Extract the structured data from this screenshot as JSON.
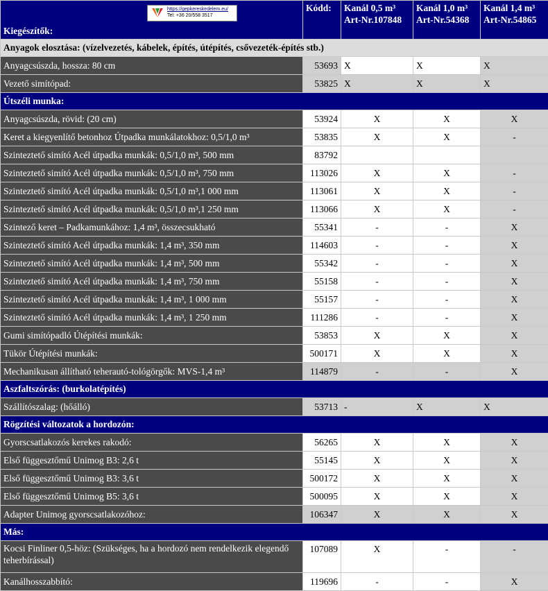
{
  "logo": {
    "url": "https://gepkereskedelem.eu/",
    "tel": "Tel:    +36 20/558 3517"
  },
  "header": {
    "title": "Kiegészítők:",
    "code": "Kódd:",
    "k1_line1": "Kanál 0,5 m³",
    "k1_line2": "Art-Nr.107848",
    "k2_line1": "Kanál 1,0 m³",
    "k2_line2": "Art-Nr.54368",
    "k3_line1": "Kanál 1,4 m³",
    "k3_line2": "Art-Nr.54865"
  },
  "sections": [
    {
      "title": "Anyagok elosztása: (vízelvezetés, kábelek, építés, útépítés, csővezeték-építés stb.)",
      "grey": true,
      "align_left": true,
      "rows": [
        {
          "name": "Anyagcsúszda, hossza: 80 cm",
          "code": "53693",
          "k1": "X",
          "k2": "X",
          "k3": "X",
          "bg": [
            "g",
            "w",
            "w",
            "g"
          ]
        },
        {
          "name": "Vezető simítópad:",
          "code": "53825",
          "k1": "X",
          "k2": "X",
          "k3": "X",
          "bg": [
            "g",
            "g",
            "g",
            "g"
          ]
        }
      ]
    },
    {
      "title": "Útszéli munka:",
      "grey": false,
      "rows": [
        {
          "name": "Anyagcsúszda, rövid: (20 cm)",
          "code": "53924",
          "k1": "X",
          "k2": "X",
          "k3": "X",
          "bg": [
            "w",
            "w",
            "w",
            "g"
          ]
        },
        {
          "name": "Keret a kiegyenlítő betonhoz Útpadka munkálatokhoz: 0,5/1,0  m³",
          "code": "53835",
          "k1": "X",
          "k2": "X",
          "k3": "-",
          "bg": [
            "w",
            "w",
            "w",
            "g"
          ]
        },
        {
          "name": "Szinteztető simító Acél útpadka munkák: 0,5/1,0 m³, 500 mm",
          "code": "83792",
          "k1": "",
          "k2": "",
          "k3": "",
          "bg": [
            "w",
            "w",
            "w",
            "g"
          ]
        },
        {
          "name": "Szinteztető simító Acél útpadka munkák: 0,5/1,0 m³, 750 mm",
          "code": "113026",
          "k1": "X",
          "k2": "X",
          "k3": "-",
          "bg": [
            "w",
            "w",
            "w",
            "g"
          ]
        },
        {
          "name": "Szinteztető simító Acél útpadka munkák: 0,5/1,0 m³,1 000 mm",
          "code": "113061",
          "k1": "X",
          "k2": "X",
          "k3": "-",
          "bg": [
            "w",
            "w",
            "w",
            "g"
          ]
        },
        {
          "name": "Szinteztető simító Acél útpadka munkák: 0,5/1,0 m³,1 250 mm",
          "code": "113066",
          "k1": "X",
          "k2": "X",
          "k3": "-",
          "bg": [
            "w",
            "w",
            "w",
            "g"
          ]
        },
        {
          "name": "Szintező keret – Padkamunkához: 1,4 m³, összecsukható",
          "code": "55341",
          "k1": "-",
          "k2": "-",
          "k3": "X",
          "bg": [
            "w",
            "w",
            "w",
            "g"
          ]
        },
        {
          "name": "Szinteztető simító Acél útpadka munkák: 1,4 m³, 350 mm",
          "code": "114603",
          "k1": "-",
          "k2": "-",
          "k3": "X",
          "bg": [
            "w",
            "w",
            "w",
            "g"
          ]
        },
        {
          "name": "Szinteztető simító Acél útpadka munkák: 1,4 m³, 500 mm",
          "code": "55342",
          "k1": "-",
          "k2": "-",
          "k3": "X",
          "bg": [
            "w",
            "w",
            "w",
            "g"
          ]
        },
        {
          "name": "Szinteztető simító Acél útpadka munkák: 1,4 m³, 750 mm",
          "code": "55158",
          "k1": "-",
          "k2": "-",
          "k3": "X",
          "bg": [
            "w",
            "w",
            "w",
            "g"
          ]
        },
        {
          "name": "Szinteztető simító Acél útpadka munkák: 1,4 m³, 1 000 mm",
          "code": "55157",
          "k1": "-",
          "k2": "-",
          "k3": "X",
          "bg": [
            "w",
            "w",
            "w",
            "g"
          ]
        },
        {
          "name": "Szinteztető simító Acél útpadka munkák: 1,4 m³, 1 250 mm",
          "code": "111286",
          "k1": "-",
          "k2": "-",
          "k3": "X",
          "bg": [
            "w",
            "w",
            "w",
            "g"
          ]
        },
        {
          "name": "Gumi simítópadló Útépítési munkák:",
          "code": "53853",
          "k1": "X",
          "k2": "X",
          "k3": "X",
          "bg": [
            "w",
            "w",
            "w",
            "g"
          ]
        },
        {
          "name": "Tükör Útépítési munkák:",
          "code": "500171",
          "k1": "X",
          "k2": "X",
          "k3": "X",
          "bg": [
            "w",
            "w",
            "w",
            "g"
          ]
        },
        {
          "name": "Mechanikusan állítható teherautó-tológörgők: MVS-1,4 m³",
          "code": "114879",
          "k1": "-",
          "k2": "-",
          "k3": "X",
          "bg": [
            "g",
            "g",
            "g",
            "g"
          ]
        }
      ]
    },
    {
      "title": "Aszfaltszórás: (burkolatépítés)",
      "grey": false,
      "align_left": true,
      "rows": [
        {
          "name": "Szállítószalag: (hőálló)",
          "code": "53713",
          "k1": "-",
          "k2": "X",
          "k3": "X",
          "bg": [
            "g",
            "g",
            "g",
            "g"
          ]
        }
      ]
    },
    {
      "title": "Rögzítési változatok a hordozón:",
      "grey": false,
      "rows": [
        {
          "name": "Gyorscsatlakozós kerekes rakodó:",
          "code": "56265",
          "k1": "X",
          "k2": "X",
          "k3": "X",
          "bg": [
            "w",
            "w",
            "w",
            "g"
          ]
        },
        {
          "name": "Első függesztőmű Unimog B3: 2,6 t",
          "code": "55145",
          "k1": "X",
          "k2": "X",
          "k3": "X",
          "bg": [
            "w",
            "w",
            "w",
            "g"
          ]
        },
        {
          "name": "Első függesztőmű Unimog B3: 3,6 t",
          "code": "500172",
          "k1": "X",
          "k2": "X",
          "k3": "X",
          "bg": [
            "w",
            "w",
            "w",
            "g"
          ]
        },
        {
          "name": "Első függesztőmű Unimog B5: 3,6 t",
          "code": "500095",
          "k1": "X",
          "k2": "X",
          "k3": "X",
          "bg": [
            "w",
            "w",
            "w",
            "g"
          ]
        },
        {
          "name": "Adapter Unimog gyorscsatlakozóhoz:",
          "code": "106347",
          "k1": "X",
          "k2": "X",
          "k3": "X",
          "bg": [
            "g",
            "g",
            "g",
            "g"
          ]
        }
      ]
    },
    {
      "title": "Más:",
      "grey": false,
      "rows": [
        {
          "name": "Kocsi Finliner 0,5-höz: (Szükséges, ha a hordozó nem rendelkezik elegendő teherbírással)",
          "code": "107089",
          "k1": "X",
          "k2": "-",
          "k3": "-",
          "bg": [
            "w",
            "w",
            "w",
            "g"
          ],
          "tall": true
        },
        {
          "name": "Kanálhosszabbító:",
          "code": "119696",
          "k1": "-",
          "k2": "-",
          "k3": "X",
          "bg": [
            "w",
            "w",
            "w",
            "g"
          ]
        }
      ]
    }
  ]
}
